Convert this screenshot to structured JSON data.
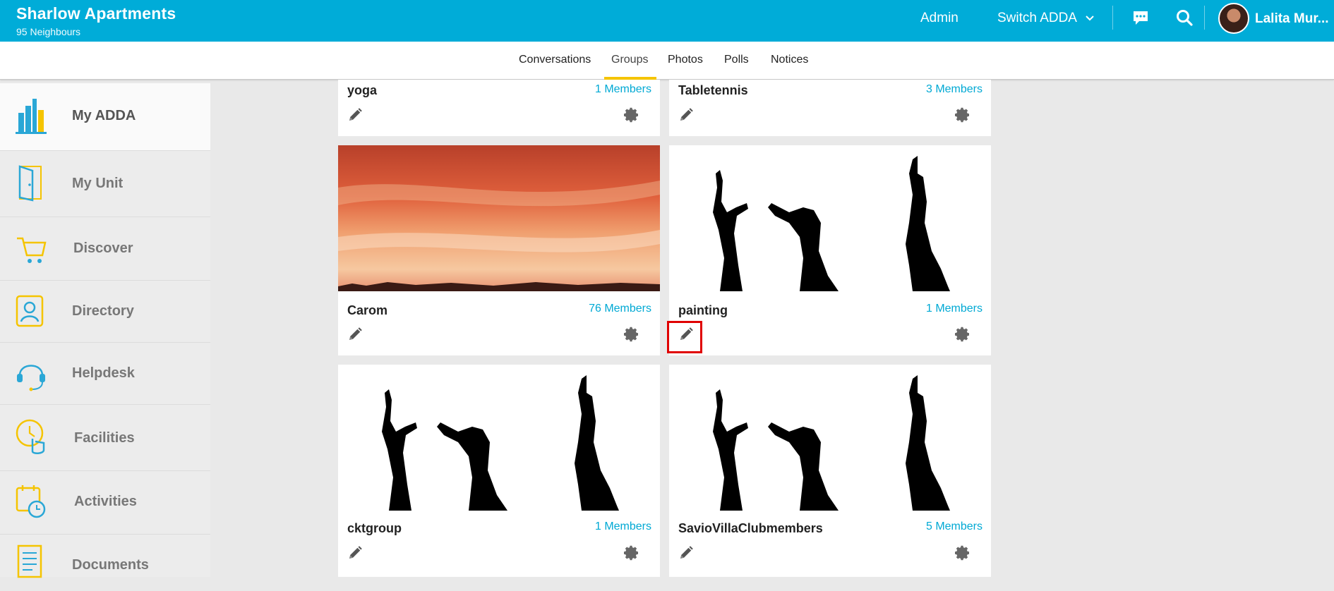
{
  "header": {
    "title": "Sharlow Apartments",
    "subtitle": "95 Neighbours",
    "admin_label": "Admin",
    "switch_label": "Switch ADDA",
    "user_name": "Lalita Mur...",
    "icons": [
      "chat-icon",
      "search-icon",
      "chevron-down-icon"
    ]
  },
  "tabs": [
    {
      "label": "Conversations"
    },
    {
      "label": "Groups",
      "active": true
    },
    {
      "label": "Photos"
    },
    {
      "label": "Polls"
    },
    {
      "label": "Notices"
    }
  ],
  "sidebar": {
    "items": [
      {
        "label": "My ADDA",
        "icon": "buildings-icon",
        "active": true
      },
      {
        "label": "My Unit",
        "icon": "door-icon"
      },
      {
        "label": "Discover",
        "icon": "cart-icon"
      },
      {
        "label": "Directory",
        "icon": "contact-book-icon"
      },
      {
        "label": "Helpdesk",
        "icon": "headset-icon"
      },
      {
        "label": "Facilities",
        "icon": "clock-hand-icon"
      },
      {
        "label": "Activities",
        "icon": "calendar-clock-icon"
      },
      {
        "label": "Documents",
        "icon": "document-icon"
      }
    ]
  },
  "groups": [
    {
      "name": "yoga",
      "members": "1 Members"
    },
    {
      "name": "Tabletennis",
      "members": "3 Members"
    },
    {
      "name": "Carom",
      "members": "76 Members",
      "image": "sunset-sky"
    },
    {
      "name": "painting",
      "members": "1 Members",
      "image": "silhouettes"
    },
    {
      "name": "cktgroup",
      "members": "1 Members",
      "image": "silhouettes"
    },
    {
      "name": "SavioVillaClubmembers",
      "members": "5 Members",
      "image": "silhouettes"
    }
  ],
  "colors": {
    "brand": "#00acd8",
    "accent": "#f5c400",
    "link": "#00a9d4",
    "highlight": "#e00000"
  }
}
